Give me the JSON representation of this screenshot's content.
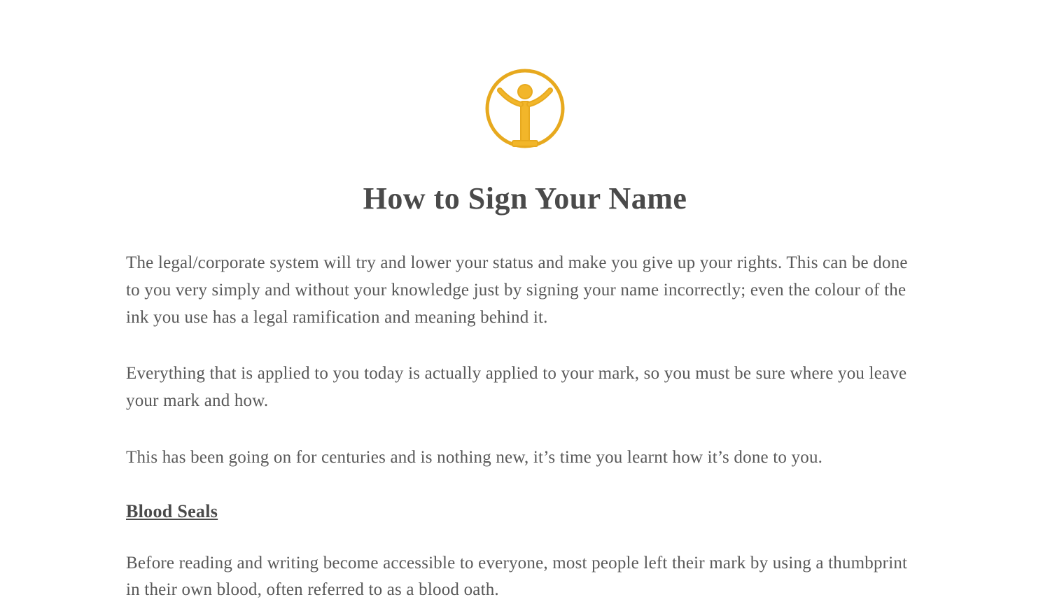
{
  "logo": {
    "name": "person-circle-emblem-icon",
    "stroke": "#e7a91e",
    "fill": "#f2b62a"
  },
  "title": "How to Sign Your Name",
  "paragraphs": [
    "The legal/corporate system will try and lower your status and make you give up your rights. This can be done to you very simply and without your knowledge just by signing your name incorrectly; even the colour of the ink you use has a legal ramification and meaning behind it.",
    "Everything that is applied to you today is actually applied to your mark, so you must be sure where you leave your mark and how.",
    "This has been going on for centuries and is nothing new, it’s time you learnt how it’s done to you."
  ],
  "subheading": "Blood Seals",
  "after_subheading": "Before reading and writing become accessible to everyone, most people left their mark by using a thumbprint in their own blood, often referred to as a blood oath."
}
